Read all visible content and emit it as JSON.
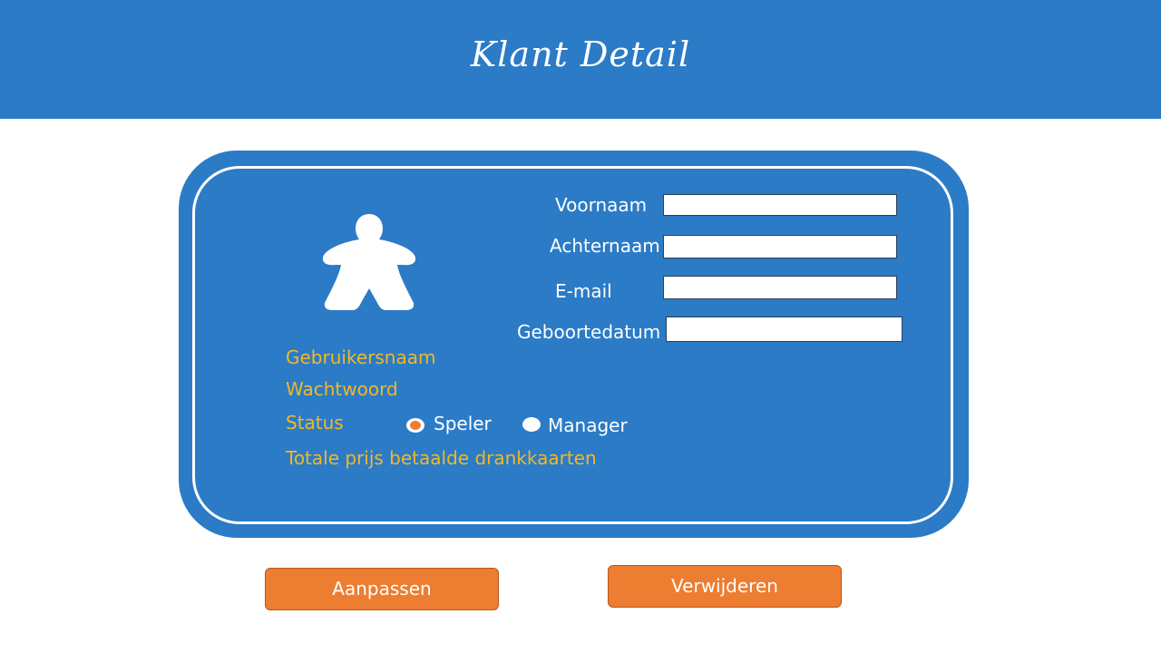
{
  "header": {
    "title": "Klant Detail",
    "color": "#2b7bc7"
  },
  "profile": {
    "avatar_icon": "meeple-icon"
  },
  "form": {
    "voornaam_label": "Voornaam",
    "voornaam_value": "",
    "achternaam_label": "Achternaam",
    "achternaam_value": "",
    "email_label": "E-mail",
    "email_value": "",
    "geboortedatum_label": "Geboortedatum",
    "geboortedatum_value": ""
  },
  "info": {
    "gebruikersnaam": "Gebruikersnaam",
    "wachtwoord": "Wachtwoord",
    "status_label": "Status",
    "totale_prijs": "Totale prijs betaalde drankkaarten",
    "color": "#f2b824"
  },
  "status_options": [
    {
      "label": "Speler",
      "selected": true
    },
    {
      "label": "Manager",
      "selected": false
    }
  ],
  "actions": {
    "aanpassen": "Aanpassen",
    "verwijderen": "Verwijderen",
    "color": "#ed7d31"
  }
}
